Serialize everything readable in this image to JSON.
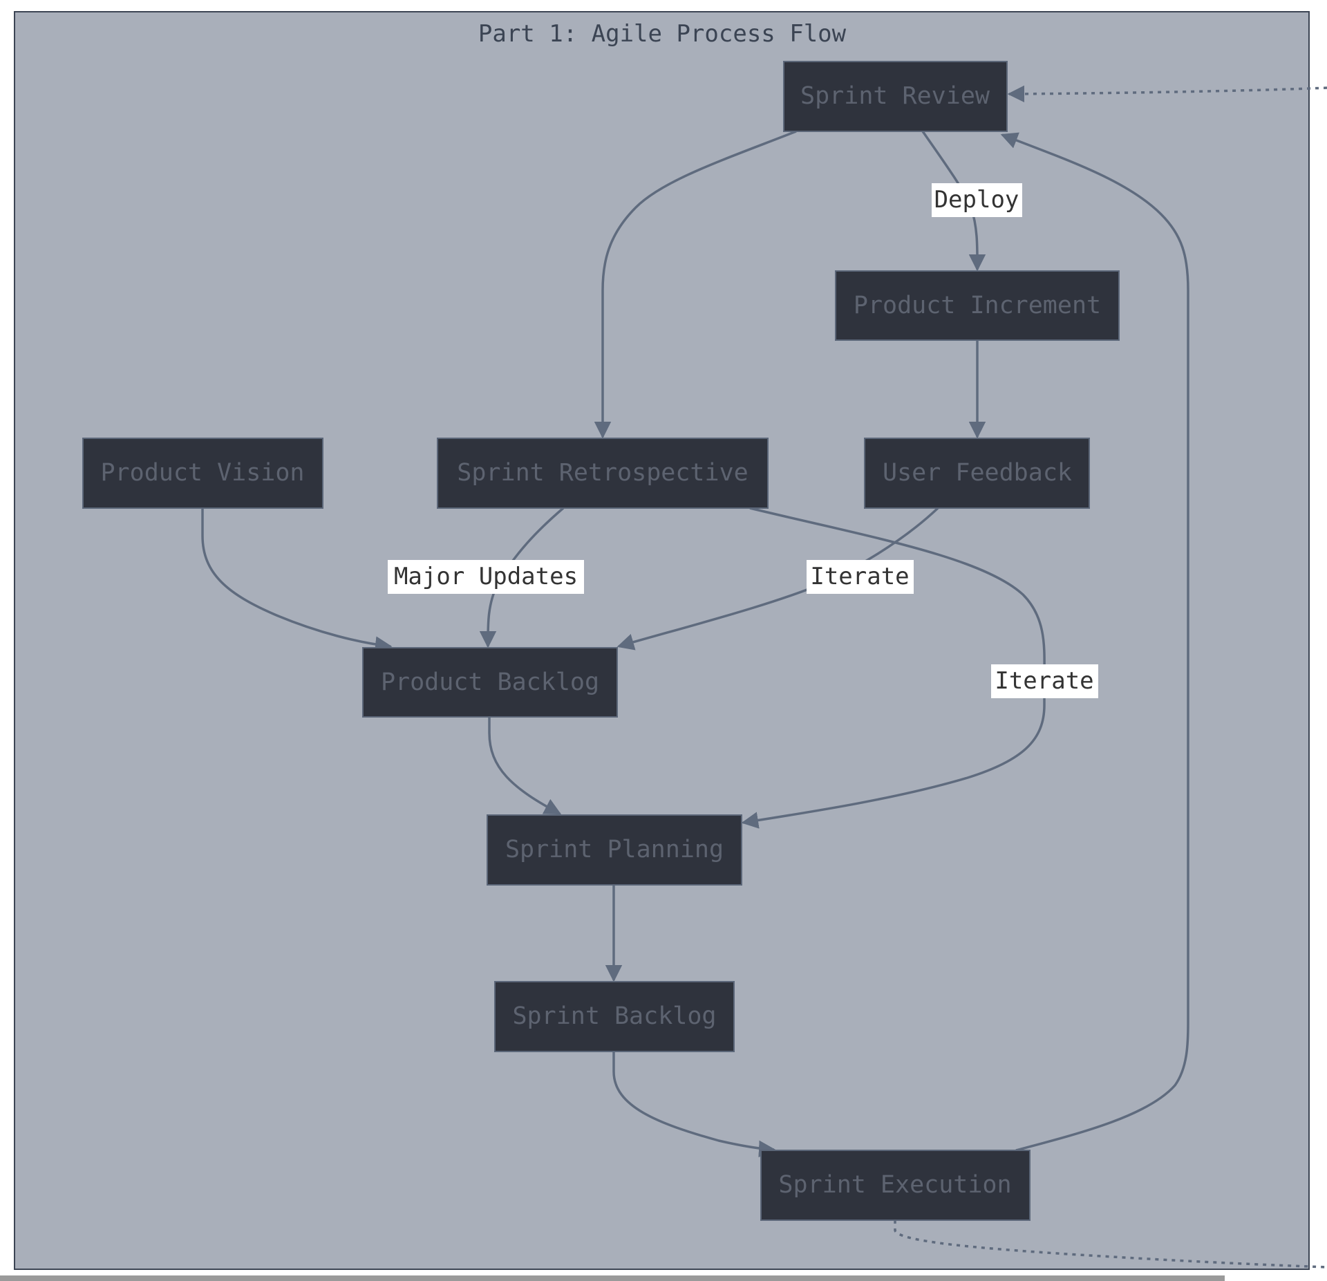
{
  "diagram": {
    "type": "flowchart",
    "cluster": {
      "title": "Part 1: Agile Process Flow",
      "fill": "#a9afba",
      "stroke": "#3b4453"
    },
    "style": {
      "node_fill": "#2f333d",
      "node_stroke": "#5b6678",
      "node_text": "#5d6370",
      "edge_color": "#5f6b7e",
      "edge_label_bg": "#ffffff",
      "edge_label_text": "#333333"
    },
    "nodes": [
      {
        "id": "sprint_review",
        "label": "Sprint Review"
      },
      {
        "id": "product_increment",
        "label": "Product Increment"
      },
      {
        "id": "product_vision",
        "label": "Product Vision"
      },
      {
        "id": "sprint_retrospective",
        "label": "Sprint Retrospective"
      },
      {
        "id": "user_feedback",
        "label": "User Feedback"
      },
      {
        "id": "product_backlog",
        "label": "Product Backlog"
      },
      {
        "id": "sprint_planning",
        "label": "Sprint Planning"
      },
      {
        "id": "sprint_backlog",
        "label": "Sprint Backlog"
      },
      {
        "id": "sprint_execution",
        "label": "Sprint Execution"
      }
    ],
    "edges": [
      {
        "from": "sprint_review",
        "to": "product_increment",
        "label": "Deploy",
        "style": "solid"
      },
      {
        "from": "sprint_review",
        "to": "sprint_retrospective",
        "label": "",
        "style": "solid"
      },
      {
        "from": "product_increment",
        "to": "user_feedback",
        "label": "",
        "style": "solid"
      },
      {
        "from": "product_vision",
        "to": "product_backlog",
        "label": "",
        "style": "solid"
      },
      {
        "from": "sprint_retrospective",
        "to": "product_backlog",
        "label": "Major Updates",
        "style": "solid"
      },
      {
        "from": "user_feedback",
        "to": "product_backlog",
        "label": "Iterate",
        "style": "solid"
      },
      {
        "from": "sprint_retrospective",
        "to": "sprint_planning",
        "label": "Iterate",
        "style": "solid"
      },
      {
        "from": "product_backlog",
        "to": "sprint_planning",
        "label": "",
        "style": "solid"
      },
      {
        "from": "sprint_planning",
        "to": "sprint_backlog",
        "label": "",
        "style": "solid"
      },
      {
        "from": "sprint_backlog",
        "to": "sprint_execution",
        "label": "",
        "style": "solid"
      },
      {
        "from": "sprint_execution",
        "to": "sprint_review",
        "label": "",
        "style": "solid"
      },
      {
        "from": "sprint_execution",
        "to": "external",
        "label": "",
        "style": "dotted"
      },
      {
        "from": "external",
        "to": "sprint_review",
        "label": "",
        "style": "dotted"
      }
    ]
  }
}
